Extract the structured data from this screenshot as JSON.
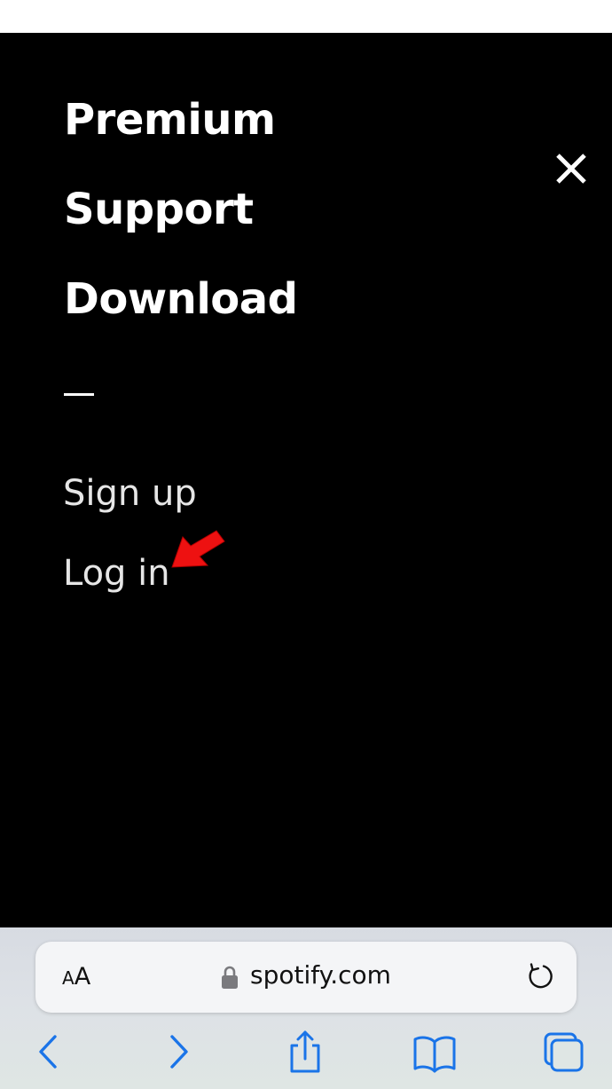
{
  "menu": {
    "items": [
      {
        "label": "Premium"
      },
      {
        "label": "Support"
      },
      {
        "label": "Download"
      }
    ],
    "divider": "—",
    "account": {
      "sign_up": "Sign up",
      "log_in": "Log in"
    },
    "close_icon": "close-icon"
  },
  "annotation": {
    "arrow_color": "#ee1111",
    "points_to": "log-in-link"
  },
  "browser": {
    "text_size_small": "A",
    "text_size_large": "A",
    "url": "spotify.com",
    "icons": [
      "lock-icon",
      "reload-icon",
      "back-icon",
      "forward-icon",
      "share-icon",
      "bookmarks-icon",
      "tabs-icon"
    ],
    "accent_color": "#1a74e8"
  },
  "colors": {
    "menu_background": "#000000",
    "menu_text": "#ffffff",
    "account_text": "#e6e6e6"
  }
}
